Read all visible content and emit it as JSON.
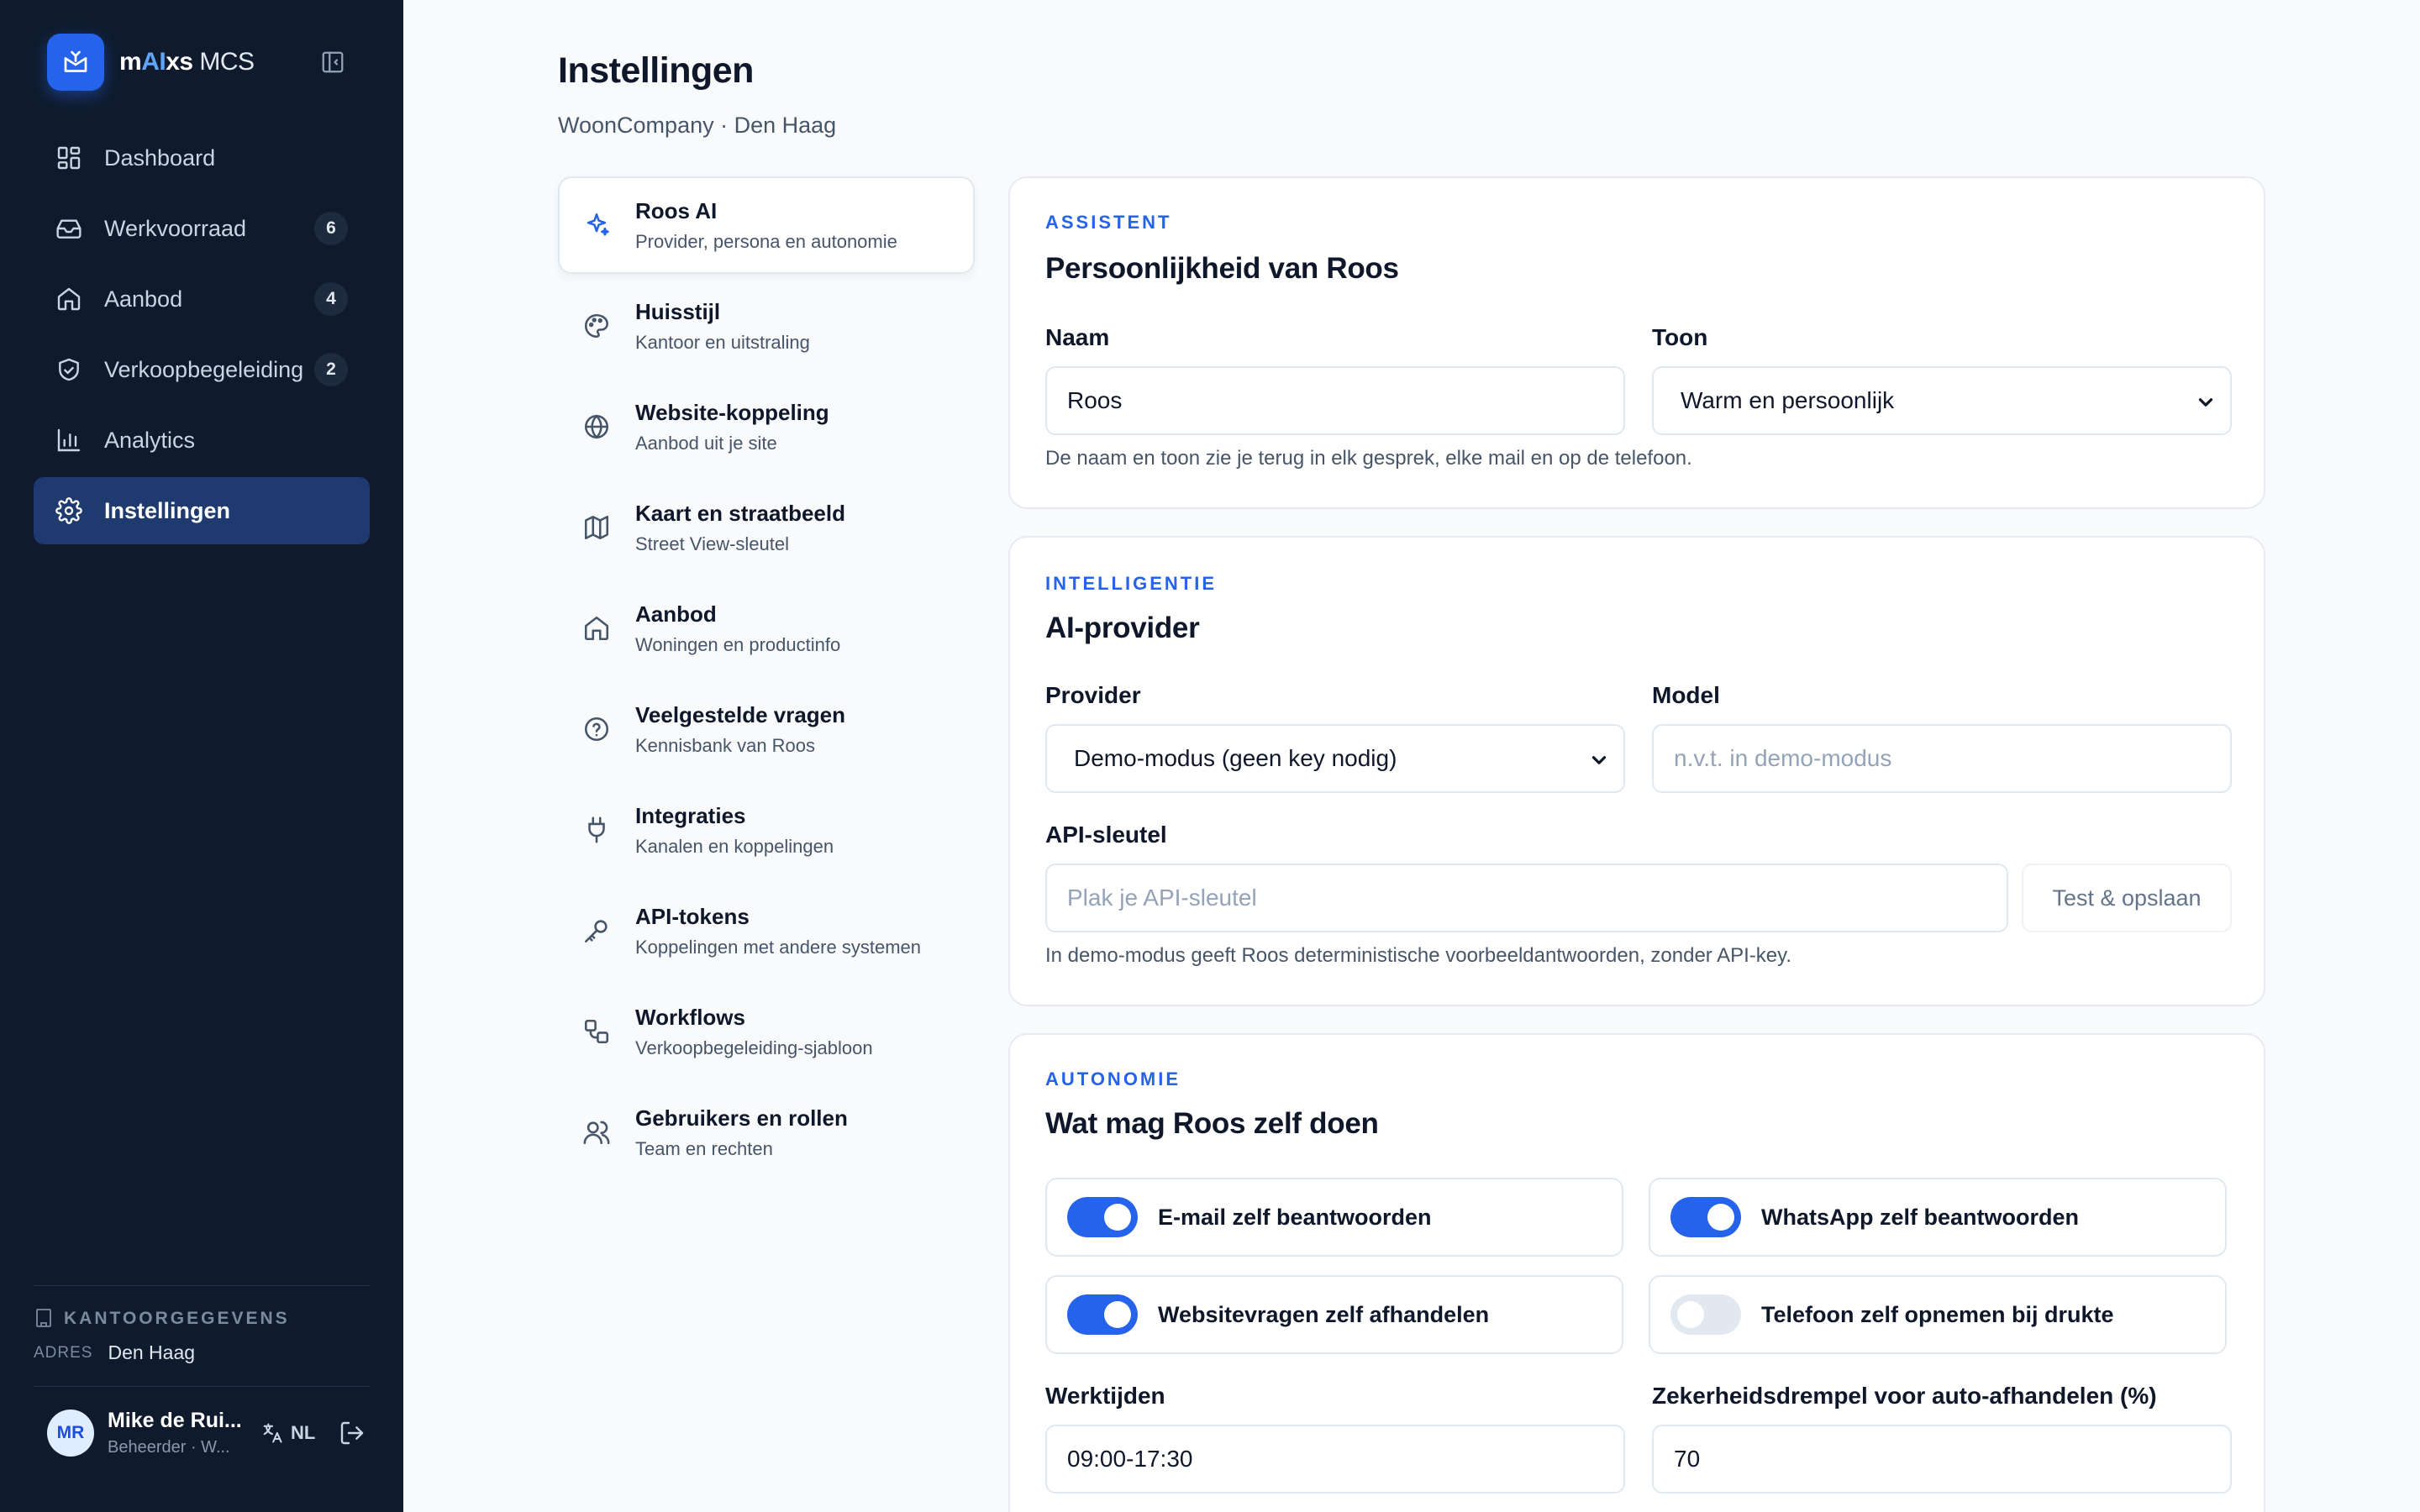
{
  "app": {
    "brand_prefix": "m",
    "brand_ai": "AI",
    "brand_suffix": "xs",
    "brand_product": "MCS"
  },
  "sidebar": {
    "items": [
      {
        "label": "Dashboard",
        "badge": null
      },
      {
        "label": "Werkvoorraad",
        "badge": "6"
      },
      {
        "label": "Aanbod",
        "badge": "4"
      },
      {
        "label": "Verkoopbegeleiding",
        "badge": "2"
      },
      {
        "label": "Analytics",
        "badge": null
      },
      {
        "label": "Instellingen",
        "badge": null,
        "active": true
      }
    ],
    "office": {
      "heading": "KANTOORGEGEVENS",
      "address_key": "ADRES",
      "address_value": "Den Haag"
    },
    "user": {
      "initials": "MR",
      "name": "Mike de Rui...",
      "role": "Beheerder · W...",
      "language": "NL"
    }
  },
  "page": {
    "title": "Instellingen",
    "subtitle": "WoonCompany · Den Haag"
  },
  "settings_nav": [
    {
      "title": "Roos AI",
      "desc": "Provider, persona en autonomie",
      "icon": "sparkle-icon",
      "active": true
    },
    {
      "title": "Huisstijl",
      "desc": "Kantoor en uitstraling",
      "icon": "palette-icon"
    },
    {
      "title": "Website-koppeling",
      "desc": "Aanbod uit je site",
      "icon": "globe-icon"
    },
    {
      "title": "Kaart en straatbeeld",
      "desc": "Street View-sleutel",
      "icon": "map-icon"
    },
    {
      "title": "Aanbod",
      "desc": "Woningen en productinfo",
      "icon": "home-icon"
    },
    {
      "title": "Veelgestelde vragen",
      "desc": "Kennisbank van Roos",
      "icon": "help-circle-icon"
    },
    {
      "title": "Integraties",
      "desc": "Kanalen en koppelingen",
      "icon": "plug-icon"
    },
    {
      "title": "API-tokens",
      "desc": "Koppelingen met andere systemen",
      "icon": "key-icon"
    },
    {
      "title": "Workflows",
      "desc": "Verkoopbegeleiding-sjabloon",
      "icon": "workflow-icon"
    },
    {
      "title": "Gebruikers en rollen",
      "desc": "Team en rechten",
      "icon": "users-icon"
    }
  ],
  "assistant_card": {
    "eyebrow": "ASSISTENT",
    "title": "Persoonlijkheid van Roos",
    "name_label": "Naam",
    "name_value": "Roos",
    "tone_label": "Toon",
    "tone_value": "Warm en persoonlijk",
    "help": "De naam en toon zie je terug in elk gesprek, elke mail en op de telefoon."
  },
  "provider_card": {
    "eyebrow": "INTELLIGENTIE",
    "title": "AI-provider",
    "provider_label": "Provider",
    "provider_value": "Demo-modus (geen key nodig)",
    "model_label": "Model",
    "model_placeholder": "n.v.t. in demo-modus",
    "api_label": "API-sleutel",
    "api_placeholder": "Plak je API-sleutel",
    "test_button": "Test & opslaan",
    "help": "In demo-modus geeft Roos deterministische voorbeeldantwoorden, zonder API-key."
  },
  "autonomy_card": {
    "eyebrow": "AUTONOMIE",
    "title": "Wat mag Roos zelf doen",
    "toggles": [
      {
        "label": "E-mail zelf beantwoorden",
        "on": true
      },
      {
        "label": "WhatsApp zelf beantwoorden",
        "on": true
      },
      {
        "label": "Websitevragen zelf afhandelen",
        "on": true
      },
      {
        "label": "Telefoon zelf opnemen bij drukte",
        "on": false
      }
    ],
    "hours_label": "Werktijden",
    "hours_value": "09:00-17:30",
    "threshold_label": "Zekerheidsdrempel voor auto-afhandelen (%)",
    "threshold_value": "70"
  },
  "colors": {
    "sidebar_bg": "#0f1b2d",
    "accent": "#2563eb",
    "active_nav": "#1e3a6e",
    "page_bg": "#f8fafc"
  }
}
